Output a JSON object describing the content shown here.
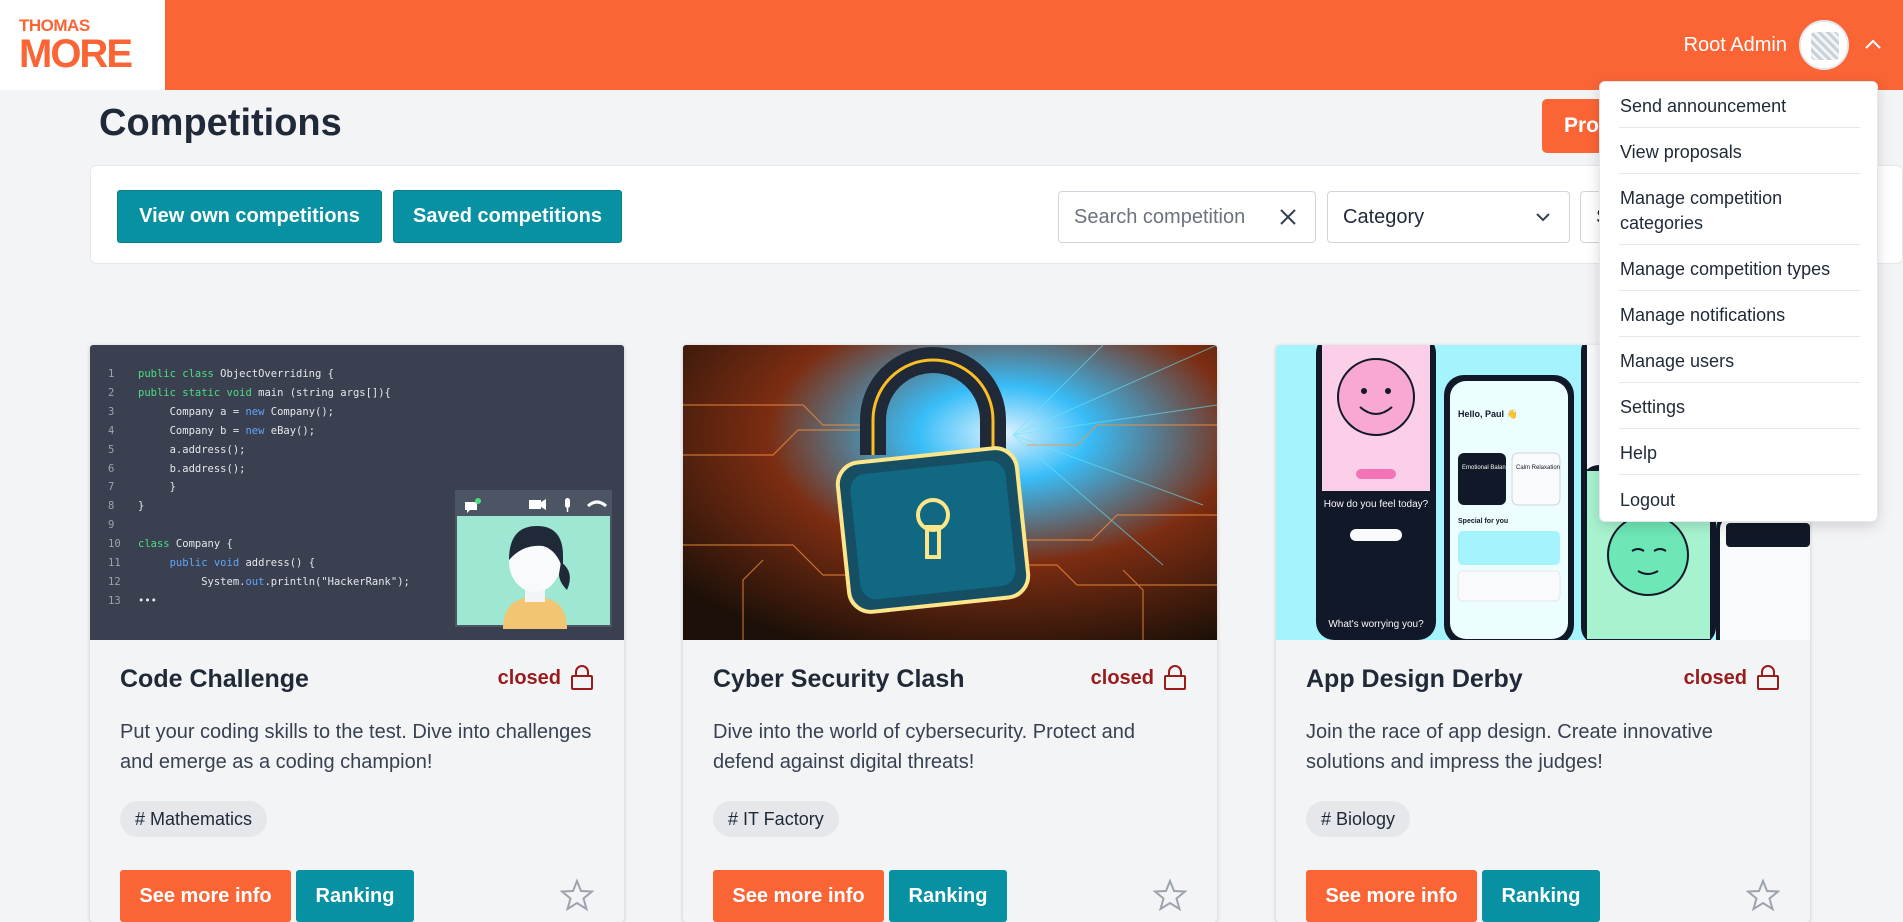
{
  "header": {
    "logo_top": "THOMAS",
    "logo_bottom": "MORE",
    "user_name": "Root Admin",
    "accent_color": "#fb6535"
  },
  "page": {
    "title": "Competitions",
    "propose_label": "Pro"
  },
  "toolbar": {
    "view_own_label": "View own competitions",
    "saved_label": "Saved competitions",
    "search_placeholder": "Search competition",
    "category_label": "Category",
    "sort_label": "S"
  },
  "cards": [
    {
      "title": "Code Challenge",
      "status": "closed",
      "description": "Put your coding skills to the test. Dive into challenges and emerge as a coding champion!",
      "tag": "# Mathematics",
      "info_label": "See more info",
      "ranking_label": "Ranking"
    },
    {
      "title": "Cyber Security Clash",
      "status": "closed",
      "description": "Dive into the world of cybersecurity. Protect and defend against digital threats!",
      "tag": "# IT Factory",
      "info_label": "See more info",
      "ranking_label": "Ranking"
    },
    {
      "title": "App Design Derby",
      "status": "closed",
      "description": "Join the race of app design. Create innovative solutions and impress the judges!",
      "tag": "# Biology",
      "info_label": "See more info",
      "ranking_label": "Ranking"
    }
  ],
  "code_image": {
    "lines": [
      {
        "n": "1",
        "a": "public class",
        "b": " ObjectOverriding {"
      },
      {
        "n": "2",
        "a": "public static void",
        "b": " main (string args[]){"
      },
      {
        "n": "3",
        "a": "",
        "b": "     Company a = ",
        "c": "new",
        "d": " Company();"
      },
      {
        "n": "4",
        "a": "",
        "b": "     Company b = ",
        "c": "new",
        "d": " eBay();"
      },
      {
        "n": "5",
        "a": "",
        "b": "     a.address();"
      },
      {
        "n": "6",
        "a": "",
        "b": "     b.address();"
      },
      {
        "n": "7",
        "a": "",
        "b": "     }"
      },
      {
        "n": "8",
        "a": "",
        "b": "}"
      },
      {
        "n": "9",
        "a": "",
        "b": ""
      },
      {
        "n": "10",
        "a": "class",
        "b": " Company {"
      },
      {
        "n": "11",
        "a": "",
        "b": "     ",
        "c": "public void",
        "d": " address() {"
      },
      {
        "n": "12",
        "a": "",
        "b": "          System.",
        "c": "out",
        "d": ".println(\"HackerRank\");"
      },
      {
        "n": "13",
        "a": "",
        "b": "•••"
      }
    ]
  },
  "app_image": {
    "greeting": "Hello, Paul 👋",
    "question1": "How do you feel today?",
    "question2": "What's worrying you?",
    "chip1": "Emotional Balance",
    "chip2": "Calm Relaxation",
    "special": "Special for you"
  },
  "menu": {
    "items": [
      "Send announcement",
      "View proposals",
      "Manage competition categories",
      "Manage competition types",
      "Manage notifications",
      "Manage users",
      "Settings",
      "Help",
      "Logout"
    ]
  }
}
